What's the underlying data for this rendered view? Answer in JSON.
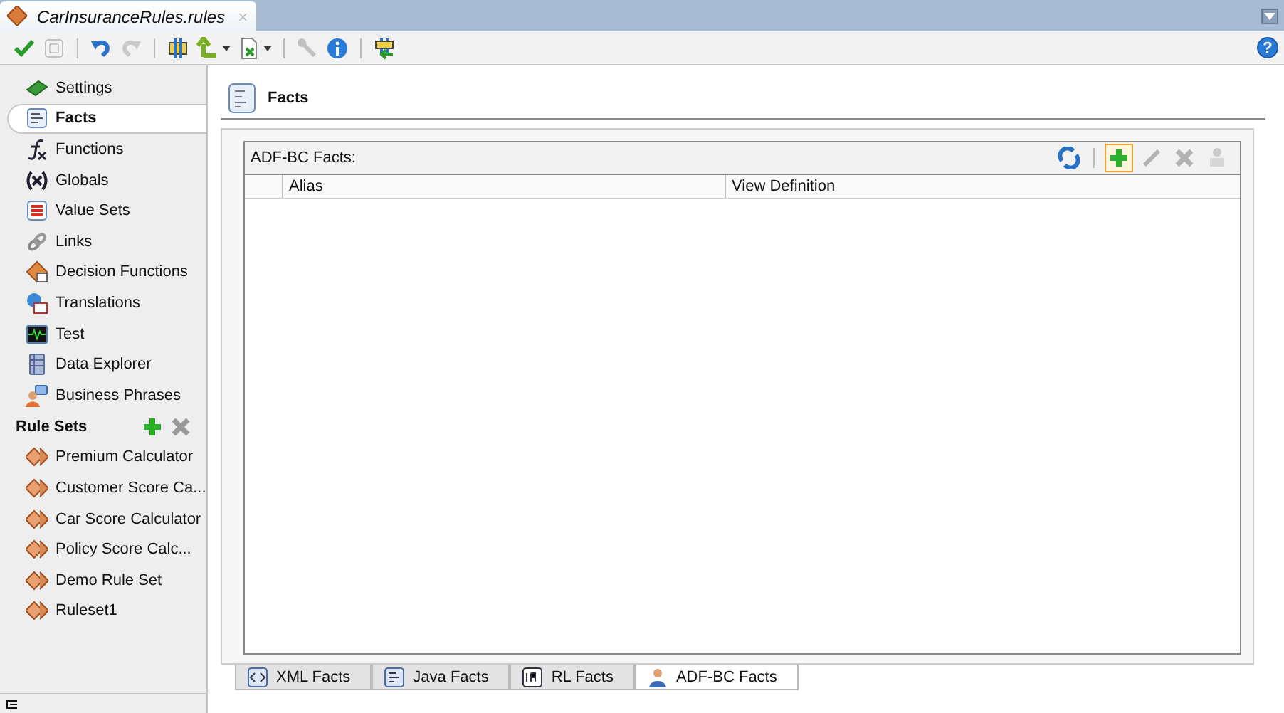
{
  "editor_tab": {
    "title": "CarInsuranceRules.rules",
    "close": "×"
  },
  "toolbar": [
    {
      "kind": "button",
      "disabled": false
    },
    {
      "kind": "button",
      "disabled": true
    },
    {
      "kind": "button",
      "disabled": false
    },
    {
      "kind": "button",
      "disabled": true
    },
    {
      "kind": "button",
      "disabled": false
    },
    {
      "kind": "dropdown",
      "disabled": false
    },
    {
      "kind": "dropdown",
      "disabled": false
    },
    {
      "kind": "button",
      "disabled": true
    },
    {
      "kind": "button",
      "disabled": false
    },
    {
      "kind": "button",
      "disabled": false
    }
  ],
  "help_button": {
    "label": "?"
  },
  "sidebar": {
    "items": [
      {
        "label": "Settings",
        "selected": false
      },
      {
        "label": "Facts",
        "selected": true
      },
      {
        "label": "Functions",
        "selected": false
      },
      {
        "label": "Globals",
        "selected": false
      },
      {
        "label": "Value Sets",
        "selected": false
      },
      {
        "label": "Links",
        "selected": false
      },
      {
        "label": "Decision Functions",
        "selected": false
      },
      {
        "label": "Translations",
        "selected": false
      },
      {
        "label": "Test",
        "selected": false
      },
      {
        "label": "Data Explorer",
        "selected": false
      },
      {
        "label": "Business Phrases",
        "selected": false
      }
    ],
    "rule_sets_heading": "Rule Sets",
    "rule_sets": [
      {
        "label": "Premium Calculator"
      },
      {
        "label": "Customer Score Ca..."
      },
      {
        "label": "Car Score Calculator"
      },
      {
        "label": "Policy Score Calc..."
      },
      {
        "label": "Demo Rule Set"
      },
      {
        "label": "Ruleset1"
      }
    ]
  },
  "page_title": "Facts",
  "facts_panel": {
    "title": "ADF-BC Facts:",
    "tools": [
      {
        "disabled": false,
        "focused": false
      },
      {
        "disabled": false,
        "focused": true
      },
      {
        "disabled": true,
        "focused": false
      },
      {
        "disabled": true,
        "focused": false
      },
      {
        "disabled": true,
        "focused": false
      }
    ],
    "columns": [
      "Alias",
      "View Definition"
    ]
  },
  "fact_tabs": [
    {
      "label": "XML Facts",
      "selected": false
    },
    {
      "label": "Java Facts",
      "selected": false
    },
    {
      "label": "RL Facts",
      "selected": false
    },
    {
      "label": "ADF-BC Facts",
      "selected": true
    }
  ]
}
